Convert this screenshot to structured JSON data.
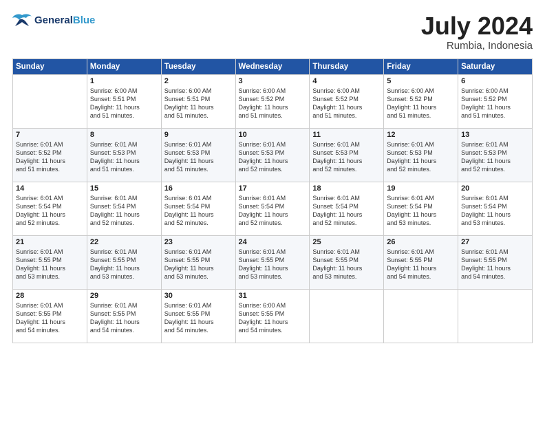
{
  "header": {
    "logo_line1": "General",
    "logo_line2": "Blue",
    "month_title": "July 2024",
    "location": "Rumbia, Indonesia"
  },
  "days_of_week": [
    "Sunday",
    "Monday",
    "Tuesday",
    "Wednesday",
    "Thursday",
    "Friday",
    "Saturday"
  ],
  "weeks": [
    [
      {
        "num": "",
        "info": ""
      },
      {
        "num": "1",
        "info": "Sunrise: 6:00 AM\nSunset: 5:51 PM\nDaylight: 11 hours\nand 51 minutes."
      },
      {
        "num": "2",
        "info": "Sunrise: 6:00 AM\nSunset: 5:51 PM\nDaylight: 11 hours\nand 51 minutes."
      },
      {
        "num": "3",
        "info": "Sunrise: 6:00 AM\nSunset: 5:52 PM\nDaylight: 11 hours\nand 51 minutes."
      },
      {
        "num": "4",
        "info": "Sunrise: 6:00 AM\nSunset: 5:52 PM\nDaylight: 11 hours\nand 51 minutes."
      },
      {
        "num": "5",
        "info": "Sunrise: 6:00 AM\nSunset: 5:52 PM\nDaylight: 11 hours\nand 51 minutes."
      },
      {
        "num": "6",
        "info": "Sunrise: 6:00 AM\nSunset: 5:52 PM\nDaylight: 11 hours\nand 51 minutes."
      }
    ],
    [
      {
        "num": "7",
        "info": "Sunrise: 6:01 AM\nSunset: 5:52 PM\nDaylight: 11 hours\nand 51 minutes."
      },
      {
        "num": "8",
        "info": "Sunrise: 6:01 AM\nSunset: 5:53 PM\nDaylight: 11 hours\nand 51 minutes."
      },
      {
        "num": "9",
        "info": "Sunrise: 6:01 AM\nSunset: 5:53 PM\nDaylight: 11 hours\nand 51 minutes."
      },
      {
        "num": "10",
        "info": "Sunrise: 6:01 AM\nSunset: 5:53 PM\nDaylight: 11 hours\nand 52 minutes."
      },
      {
        "num": "11",
        "info": "Sunrise: 6:01 AM\nSunset: 5:53 PM\nDaylight: 11 hours\nand 52 minutes."
      },
      {
        "num": "12",
        "info": "Sunrise: 6:01 AM\nSunset: 5:53 PM\nDaylight: 11 hours\nand 52 minutes."
      },
      {
        "num": "13",
        "info": "Sunrise: 6:01 AM\nSunset: 5:53 PM\nDaylight: 11 hours\nand 52 minutes."
      }
    ],
    [
      {
        "num": "14",
        "info": "Sunrise: 6:01 AM\nSunset: 5:54 PM\nDaylight: 11 hours\nand 52 minutes."
      },
      {
        "num": "15",
        "info": "Sunrise: 6:01 AM\nSunset: 5:54 PM\nDaylight: 11 hours\nand 52 minutes."
      },
      {
        "num": "16",
        "info": "Sunrise: 6:01 AM\nSunset: 5:54 PM\nDaylight: 11 hours\nand 52 minutes."
      },
      {
        "num": "17",
        "info": "Sunrise: 6:01 AM\nSunset: 5:54 PM\nDaylight: 11 hours\nand 52 minutes."
      },
      {
        "num": "18",
        "info": "Sunrise: 6:01 AM\nSunset: 5:54 PM\nDaylight: 11 hours\nand 52 minutes."
      },
      {
        "num": "19",
        "info": "Sunrise: 6:01 AM\nSunset: 5:54 PM\nDaylight: 11 hours\nand 53 minutes."
      },
      {
        "num": "20",
        "info": "Sunrise: 6:01 AM\nSunset: 5:54 PM\nDaylight: 11 hours\nand 53 minutes."
      }
    ],
    [
      {
        "num": "21",
        "info": "Sunrise: 6:01 AM\nSunset: 5:55 PM\nDaylight: 11 hours\nand 53 minutes."
      },
      {
        "num": "22",
        "info": "Sunrise: 6:01 AM\nSunset: 5:55 PM\nDaylight: 11 hours\nand 53 minutes."
      },
      {
        "num": "23",
        "info": "Sunrise: 6:01 AM\nSunset: 5:55 PM\nDaylight: 11 hours\nand 53 minutes."
      },
      {
        "num": "24",
        "info": "Sunrise: 6:01 AM\nSunset: 5:55 PM\nDaylight: 11 hours\nand 53 minutes."
      },
      {
        "num": "25",
        "info": "Sunrise: 6:01 AM\nSunset: 5:55 PM\nDaylight: 11 hours\nand 53 minutes."
      },
      {
        "num": "26",
        "info": "Sunrise: 6:01 AM\nSunset: 5:55 PM\nDaylight: 11 hours\nand 54 minutes."
      },
      {
        "num": "27",
        "info": "Sunrise: 6:01 AM\nSunset: 5:55 PM\nDaylight: 11 hours\nand 54 minutes."
      }
    ],
    [
      {
        "num": "28",
        "info": "Sunrise: 6:01 AM\nSunset: 5:55 PM\nDaylight: 11 hours\nand 54 minutes."
      },
      {
        "num": "29",
        "info": "Sunrise: 6:01 AM\nSunset: 5:55 PM\nDaylight: 11 hours\nand 54 minutes."
      },
      {
        "num": "30",
        "info": "Sunrise: 6:01 AM\nSunset: 5:55 PM\nDaylight: 11 hours\nand 54 minutes."
      },
      {
        "num": "31",
        "info": "Sunrise: 6:00 AM\nSunset: 5:55 PM\nDaylight: 11 hours\nand 54 minutes."
      },
      {
        "num": "",
        "info": ""
      },
      {
        "num": "",
        "info": ""
      },
      {
        "num": "",
        "info": ""
      }
    ]
  ]
}
